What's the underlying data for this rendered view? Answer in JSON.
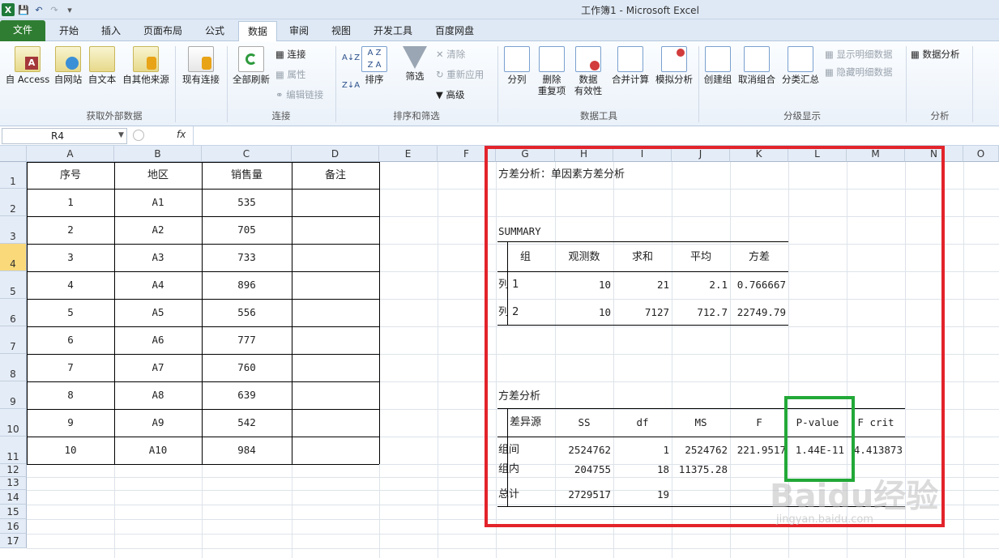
{
  "title": "工作簿1 - Microsoft Excel",
  "tabs": [
    "文件",
    "开始",
    "插入",
    "页面布局",
    "公式",
    "数据",
    "审阅",
    "视图",
    "开发工具",
    "百度网盘"
  ],
  "ribbon": {
    "get_external": {
      "label": "获取外部数据",
      "access": "自 Access",
      "web": "自网站",
      "text": "自文本",
      "other": "自其他来源",
      "existing": "现有连接"
    },
    "connections": {
      "label": "连接",
      "refresh": "全部刷新",
      "conn": "连接",
      "props": "属性",
      "edit_links": "编辑链接"
    },
    "sort_filter": {
      "label": "排序和筛选",
      "sort": "排序",
      "filter": "筛选",
      "clear": "清除",
      "reapply": "重新应用",
      "advanced": "高级"
    },
    "data_tools": {
      "label": "数据工具",
      "split": "分列",
      "dup1": "删除",
      "dup2": "重复项",
      "valid1": "数据",
      "valid2": "有效性",
      "consolidate": "合并计算",
      "whatif": "模拟分析"
    },
    "outline": {
      "label": "分级显示",
      "group": "创建组",
      "ungroup": "取消组合",
      "subtotal": "分类汇总",
      "show": "显示明细数据",
      "hide": "隐藏明细数据"
    },
    "analysis": {
      "label": "分析",
      "data_analysis": "数据分析"
    }
  },
  "namebox": "R4",
  "fx": "fx",
  "columns": [
    "A",
    "B",
    "C",
    "D",
    "E",
    "F",
    "G",
    "H",
    "I",
    "J",
    "K",
    "L",
    "M",
    "N",
    "O"
  ],
  "rows": [
    "1",
    "2",
    "3",
    "4",
    "5",
    "6",
    "7",
    "8",
    "9",
    "10",
    "11",
    "12",
    "13",
    "14",
    "15",
    "16",
    "17"
  ],
  "selected_row": "4",
  "left_table": {
    "headers": [
      "序号",
      "地区",
      "销售量",
      "备注"
    ],
    "rows": [
      [
        "1",
        "A1",
        "535",
        ""
      ],
      [
        "2",
        "A2",
        "705",
        ""
      ],
      [
        "3",
        "A3",
        "733",
        ""
      ],
      [
        "4",
        "A4",
        "896",
        ""
      ],
      [
        "5",
        "A5",
        "556",
        ""
      ],
      [
        "6",
        "A6",
        "777",
        ""
      ],
      [
        "7",
        "A7",
        "760",
        ""
      ],
      [
        "8",
        "A8",
        "639",
        ""
      ],
      [
        "9",
        "A9",
        "542",
        ""
      ],
      [
        "10",
        "A10",
        "984",
        ""
      ]
    ]
  },
  "anova": {
    "title": "方差分析：单因素方差分析",
    "summary_label": "SUMMARY",
    "summary_headers": [
      "组",
      "观测数",
      "求和",
      "平均",
      "方差"
    ],
    "summary_rows": [
      [
        "列 1",
        "10",
        "21",
        "2.1",
        "0.766667"
      ],
      [
        "列 2",
        "10",
        "7127",
        "712.7",
        "22749.79"
      ]
    ],
    "anova_label": "方差分析",
    "anova_headers": [
      "差异源",
      "SS",
      "df",
      "MS",
      "F",
      "P-value",
      "F crit"
    ],
    "anova_rows": [
      [
        "组间",
        "2524762",
        "1",
        "2524762",
        "221.9517",
        "1.44E-11",
        "4.413873"
      ],
      [
        "组内",
        "204755",
        "18",
        "11375.28",
        "",
        "",
        ""
      ],
      [
        "总计",
        "2729517",
        "19",
        "",
        "",
        "",
        ""
      ]
    ]
  },
  "colors": {
    "highlight_red": "#e3232b",
    "highlight_green": "#22a838",
    "file_tab": "#2f7d32"
  }
}
